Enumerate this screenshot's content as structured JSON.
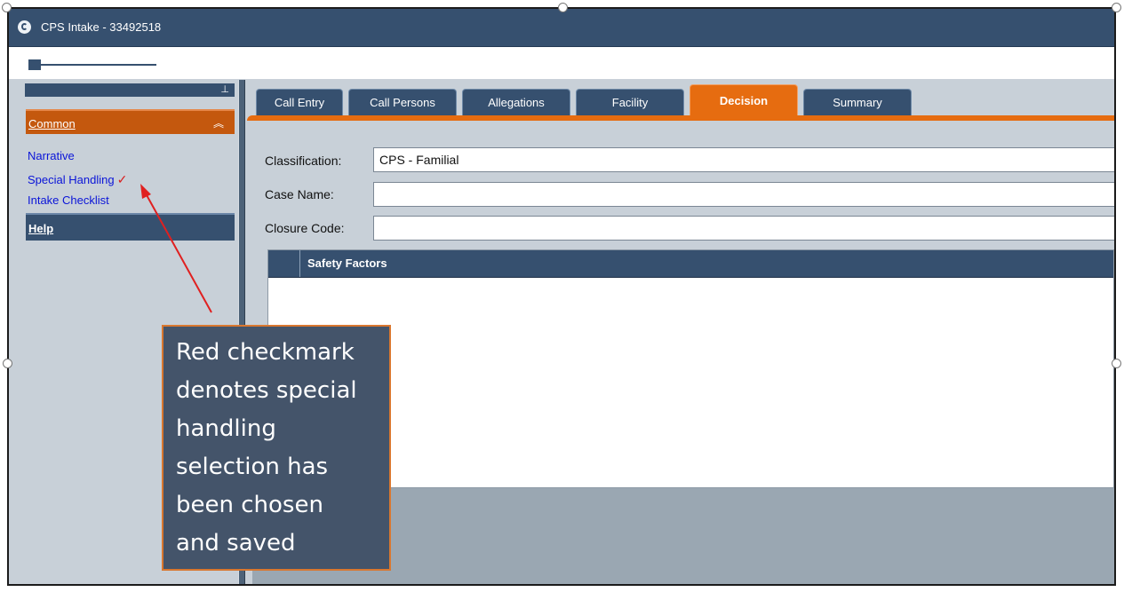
{
  "window": {
    "title": "CPS Intake - 33492518"
  },
  "sidebar": {
    "section_label": "Common",
    "items": [
      {
        "label": "Narrative"
      },
      {
        "label": "Special Handling",
        "checked": true
      },
      {
        "label": "Intake Checklist"
      }
    ],
    "help_label": "Help"
  },
  "tabs": [
    {
      "label": "Call Entry",
      "active": false
    },
    {
      "label": "Call Persons",
      "active": false
    },
    {
      "label": "Allegations",
      "active": false
    },
    {
      "label": "Facility",
      "active": false
    },
    {
      "label": "Decision",
      "active": true
    },
    {
      "label": "Summary",
      "active": false
    }
  ],
  "form": {
    "classification_label": "Classification:",
    "classification_value": "CPS - Familial",
    "case_name_label": "Case Name:",
    "case_name_value": "",
    "closure_code_label": "Closure Code:",
    "closure_code_value": ""
  },
  "grid": {
    "title": "Safety Factors"
  },
  "annotation": {
    "text_lines": [
      "Red checkmark",
      "denotes special",
      "handling",
      "selection has",
      "been chosen",
      "and saved"
    ]
  },
  "colors": {
    "title_bar": "#36506f",
    "accent_orange": "#e66c10",
    "panel_bg": "#c8d0d8",
    "link_blue": "#0a14d8",
    "check_red": "#d81f1f",
    "callout_bg": "#44546a"
  },
  "icons": {
    "app": "app-logo-icon",
    "pin": "pin-icon",
    "collapse": "double-chevron-up-icon",
    "check": "red-checkmark-icon"
  }
}
